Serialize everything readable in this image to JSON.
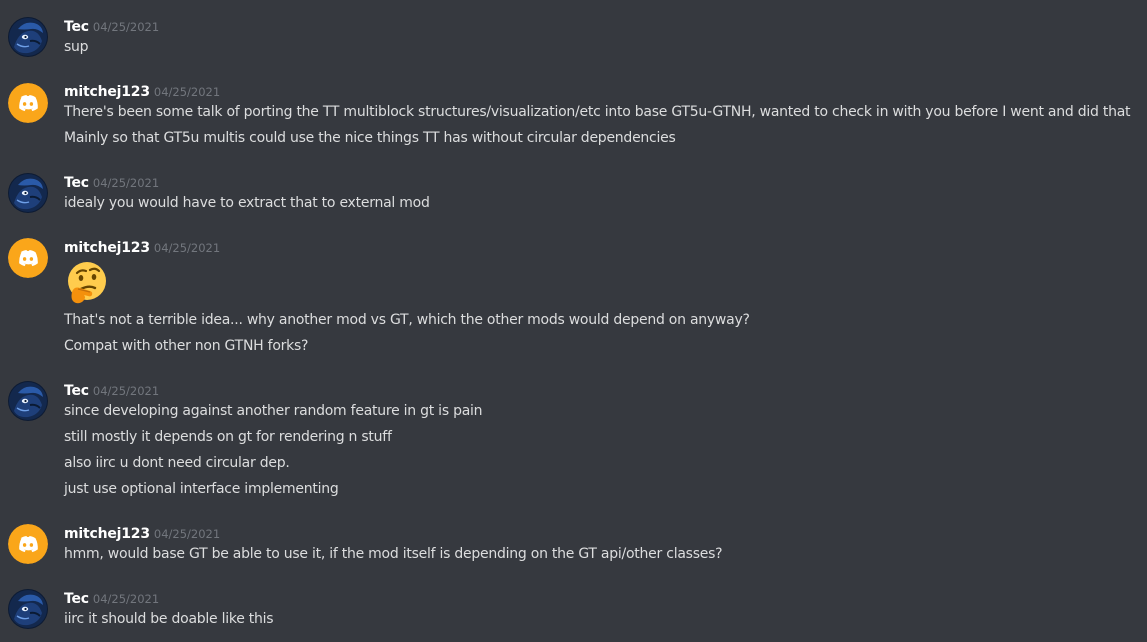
{
  "messages": [
    {
      "author": "Tec",
      "avatar_icon": "tec-avatar-icon",
      "timestamp": "04/25/2021",
      "lines": [
        "sup"
      ]
    },
    {
      "author": "mitchej123",
      "avatar_icon": "discord-default-avatar-icon",
      "timestamp": "04/25/2021",
      "lines": [
        "There's been some talk of porting the TT multiblock structures/visualization/etc into base GT5u-GTNH, wanted to check in with you before I went and did that",
        "Mainly so that GT5u multis could use the nice things TT has without circular dependencies"
      ]
    },
    {
      "author": "Tec",
      "avatar_icon": "tec-avatar-icon",
      "timestamp": "04/25/2021",
      "lines": [
        "idealy you would have to extract that to external mod"
      ]
    },
    {
      "author": "mitchej123",
      "avatar_icon": "discord-default-avatar-icon",
      "timestamp": "04/25/2021",
      "emoji": "thinking-face-icon",
      "lines": [
        "That's not a terrible idea... why another mod vs GT, which the other mods would depend on anyway?",
        "Compat with other non GTNH forks?"
      ]
    },
    {
      "author": "Tec",
      "avatar_icon": "tec-avatar-icon",
      "timestamp": "04/25/2021",
      "lines": [
        "since developing against another random feature in gt is pain",
        "still mostly it depends on gt for rendering n stuff",
        "also iirc u dont need circular dep.",
        "just use optional interface implementing"
      ]
    },
    {
      "author": "mitchej123",
      "avatar_icon": "discord-default-avatar-icon",
      "timestamp": "04/25/2021",
      "lines": [
        "hmm, would base GT be able to use it, if the mod itself is depending on the GT api/other classes?"
      ]
    },
    {
      "author": "Tec",
      "avatar_icon": "tec-avatar-icon",
      "timestamp": "04/25/2021",
      "lines": [
        "iirc it should be doable like this"
      ]
    }
  ],
  "colors": {
    "background": "#36393f",
    "username": "#ffffff",
    "timestamp": "#72767d",
    "text": "#dcddde",
    "discord_avatar_bg": "#faa61a"
  }
}
